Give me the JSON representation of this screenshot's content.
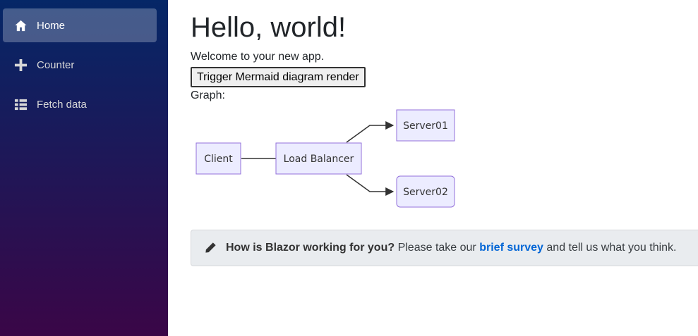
{
  "sidebar": {
    "items": [
      {
        "label": "Home",
        "icon": "home-icon",
        "active": true
      },
      {
        "label": "Counter",
        "icon": "plus-icon"
      },
      {
        "label": "Fetch data",
        "icon": "list-icon"
      }
    ]
  },
  "main": {
    "title": "Hello, world!",
    "welcome": "Welcome to your new app.",
    "trigger_button": "Trigger Mermaid diagram render",
    "graph_label": "Graph:"
  },
  "diagram": {
    "nodes": {
      "client": "Client",
      "load_balancer": "Load Balancer",
      "server01": "Server01",
      "server02": "Server02"
    },
    "colors": {
      "node_fill": "#ECECFF",
      "node_stroke": "#9370DB",
      "edge": "#333333"
    }
  },
  "survey": {
    "question": "How is Blazor working for you?",
    "text_before": "Please take our",
    "link_text": "brief survey",
    "text_after": "and tell us what you think."
  }
}
